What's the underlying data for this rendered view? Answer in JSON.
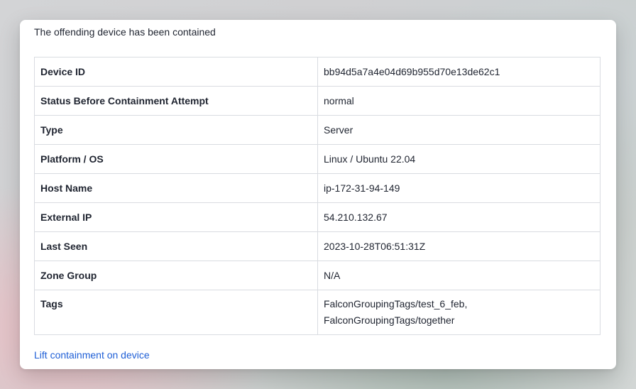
{
  "message": "The offending device has been contained",
  "details": {
    "rows": [
      {
        "key": "Device ID",
        "value": "bb94d5a7a4e04d69b955d70e13de62c1"
      },
      {
        "key": "Status Before Containment Attempt",
        "value": "normal"
      },
      {
        "key": "Type",
        "value": "Server"
      },
      {
        "key": "Platform / OS",
        "value": "Linux / Ubuntu 22.04"
      },
      {
        "key": "Host Name",
        "value": "ip-172-31-94-149"
      },
      {
        "key": "External IP",
        "value": "54.210.132.67"
      },
      {
        "key": "Last Seen",
        "value": "2023-10-28T06:51:31Z"
      },
      {
        "key": "Zone Group",
        "value": "N/A"
      }
    ],
    "tags": {
      "key": "Tags",
      "values": [
        "FalconGroupingTags/test_6_feb,",
        "FalconGroupingTags/together"
      ]
    }
  },
  "actions": {
    "lift_label": "Lift containment on device"
  },
  "colors": {
    "link": "#1f5fd6",
    "text": "#1f2430",
    "border": "#d9dce1"
  }
}
